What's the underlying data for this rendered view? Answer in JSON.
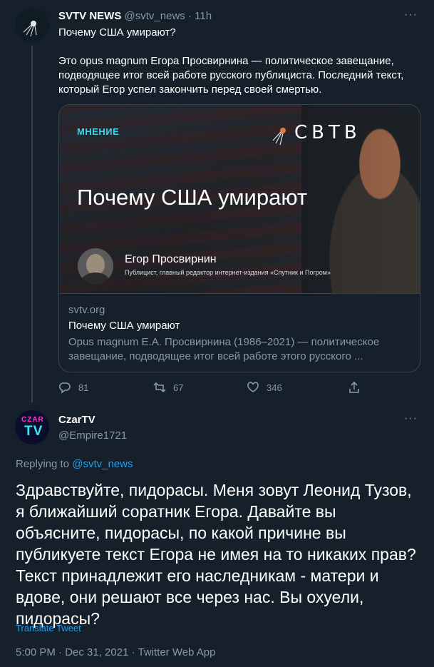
{
  "tweet1": {
    "author_name": "SVTV NEWS",
    "author_handle": "@svtv_news",
    "separator": "·",
    "time": "11h",
    "more_label": "···",
    "title": "Почему США умирают?",
    "body": "Это opus magnum Егора Просвирнина — политическое завещание, подводящее итог всей работе русского публициста. Последний текст, который Егор успел закончить перед своей смертью.",
    "card": {
      "badge": "МНЕНИЕ",
      "logo_text": "СВТВ",
      "headline": "Почему США умирают",
      "author_name": "Егор Просвирнин",
      "author_subtitle": "Публицист, главный редактор интернет-издания «Спутник и Погром»",
      "domain": "svtv.org",
      "title": "Почему США умирают",
      "description": "Opus magnum Е.А. Просвирнина (1986–2021) — политическое завещание, подводящее итог всей работе этого русского ..."
    },
    "actions": {
      "replies": "81",
      "retweets": "67",
      "likes": "346"
    }
  },
  "tweet2": {
    "avatar_top": "CZAR",
    "avatar_bottom": "TV",
    "author_name": "CzarTV",
    "author_handle": "@Empire1721",
    "more_label": "···",
    "replying_prefix": "Replying to",
    "replying_to": "@svtv_news",
    "text": "Здравствуйте, пидорасы. Меня зовут Леонид Тузов, я ближайший соратник Егора. Давайте вы объясните, пидорасы, по какой причине вы публикуете текст Егора не имея на то никаких прав? Текст принадлежит его наследникам - матери и вдове, они решают все через нас. Вы охуели, пидорасы?",
    "translate_label": "Translate Tweet",
    "meta": "5:00 PM · Dec 31, 2021 · Twitter Web App"
  },
  "colors": {
    "background": "#15202b",
    "border": "#38444d",
    "secondary_text": "#8899a6",
    "link": "#1da1f2",
    "badge": "#3ed4e8"
  },
  "icons": [
    "reply-icon",
    "retweet-icon",
    "like-icon",
    "share-icon",
    "satellite-icon"
  ]
}
